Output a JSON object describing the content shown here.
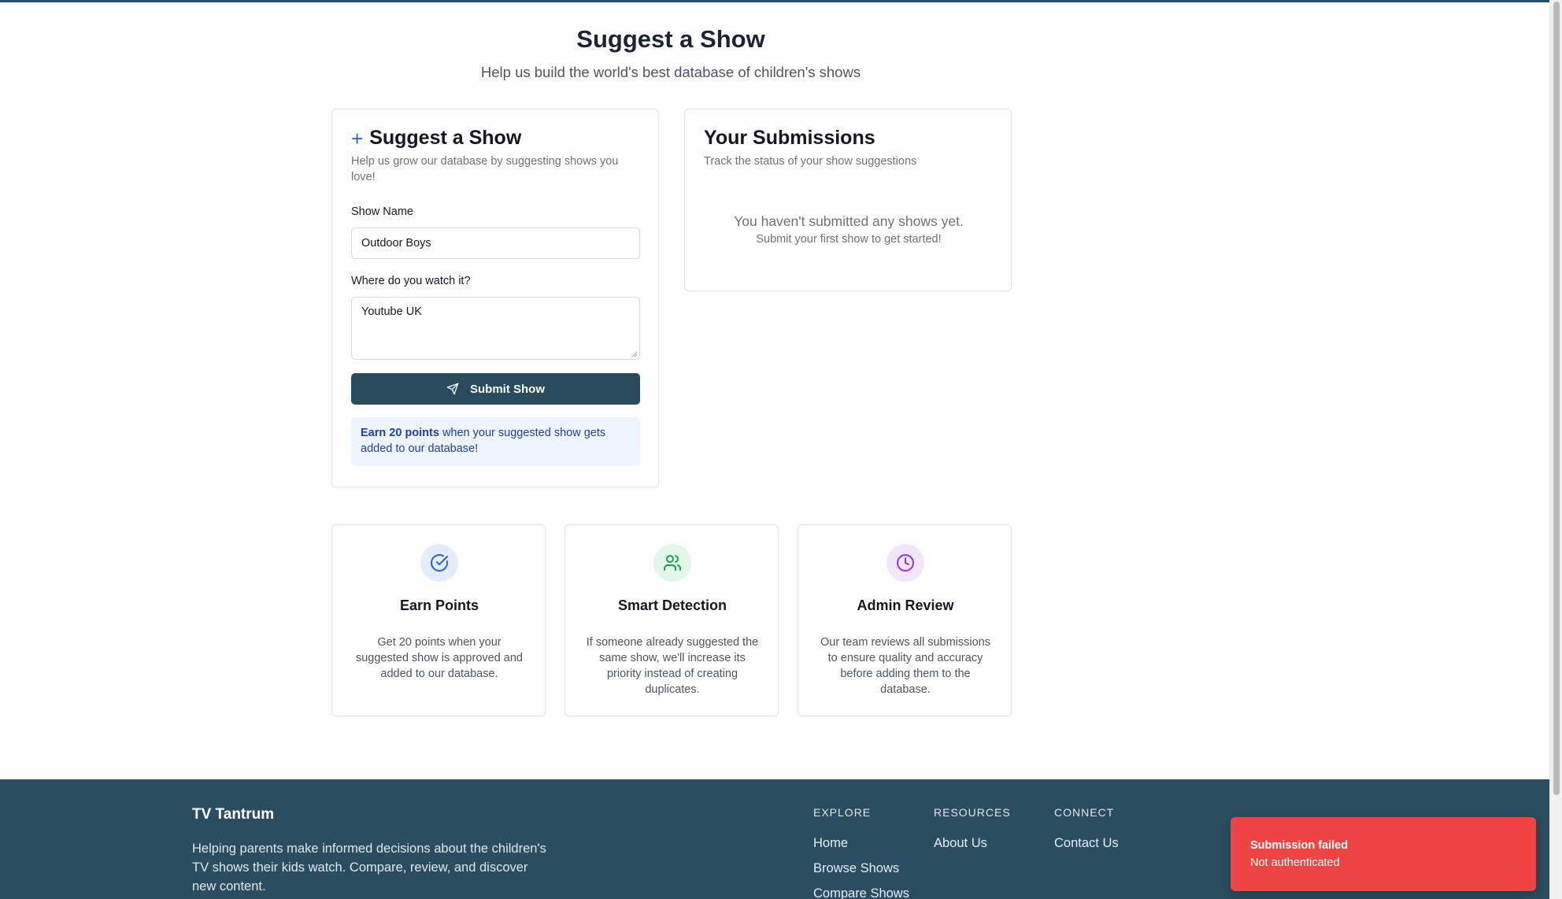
{
  "header": {
    "title": "Suggest a Show",
    "subtitle": "Help us build the world's best database of children's shows"
  },
  "form": {
    "title": "Suggest a Show",
    "description": "Help us grow our database by suggesting shows you love!",
    "show_name_label": "Show Name",
    "show_name_value": "Outdoor Boys",
    "where_label": "Where do you watch it?",
    "where_value": "Youtube UK",
    "submit_label": "Submit Show",
    "info_bold": "Earn 20 points",
    "info_rest": " when your suggested show gets added to our database!"
  },
  "submissions": {
    "title": "Your Submissions",
    "description": "Track the status of your show suggestions",
    "empty_main": "You haven't submitted any shows yet.",
    "empty_sub": "Submit your first show to get started!"
  },
  "features": [
    {
      "title": "Earn Points",
      "description": "Get 20 points when your suggested show is approved and added to our database.",
      "icon": "check-circle-icon",
      "color": "#2563eb",
      "bg": "#e3edfd"
    },
    {
      "title": "Smart Detection",
      "description": "If someone already suggested the same show, we'll increase its priority instead of creating duplicates.",
      "icon": "users-icon",
      "color": "#16a34a",
      "bg": "#e2f6ea"
    },
    {
      "title": "Admin Review",
      "description": "Our team reviews all submissions to ensure quality and accuracy before adding them to the database.",
      "icon": "clock-icon",
      "color": "#9333ea",
      "bg": "#f1e6fc"
    }
  ],
  "footer": {
    "brand": "TV Tantrum",
    "brand_desc": "Helping parents make informed decisions about the children's TV shows their kids watch. Compare, review, and discover new content.",
    "explore": {
      "heading": "EXPLORE",
      "links": [
        "Home",
        "Browse Shows",
        "Compare Shows"
      ]
    },
    "resources": {
      "heading": "RESOURCES",
      "links": [
        "About Us"
      ]
    },
    "connect": {
      "heading": "CONNECT",
      "links": [
        "Contact Us"
      ]
    }
  },
  "toast": {
    "title": "Submission failed",
    "message": "Not authenticated",
    "color": "#ef4444"
  }
}
